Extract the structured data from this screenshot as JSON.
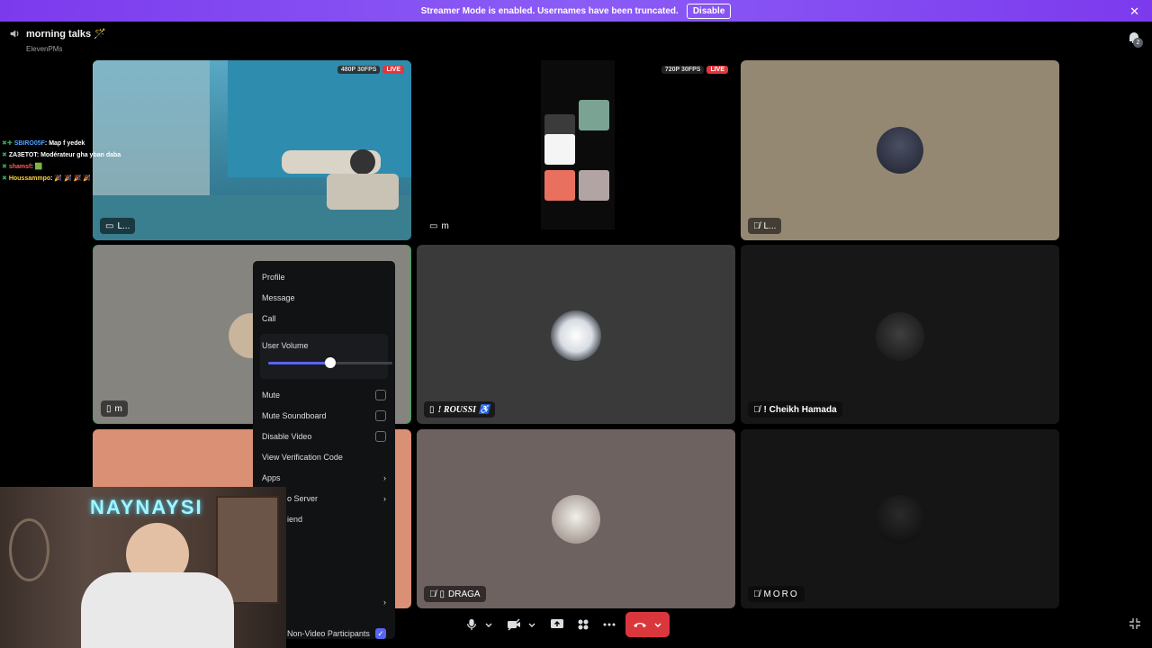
{
  "banner": {
    "message": "Streamer Mode is enabled. Usernames have been truncated.",
    "disable_label": "Disable",
    "close_glyph": "✕"
  },
  "header": {
    "channel_name": "morning talks 🪄",
    "server_name": "ElevenPMs"
  },
  "notifications": {
    "count": "2"
  },
  "tiles": [
    {
      "name": "L...",
      "quality": "480P 30FPS",
      "live": "LIVE"
    },
    {
      "name": "m",
      "quality": "720P 30FPS",
      "live": "LIVE"
    },
    {
      "name": "L..."
    },
    {
      "name": "m"
    },
    {
      "name": "! ROUSSI ♿"
    },
    {
      "name": "! Cheikh Hamada"
    },
    {
      "name": "DRAGA"
    },
    {
      "name": "MORO"
    }
  ],
  "chat_overlay": [
    {
      "user": "SBIRO05F",
      "user_color": "#4fa3ff",
      "text": ": Map f yedek"
    },
    {
      "user": "ZA3ETOT",
      "user_color": "#ffffff",
      "text": ": Modérateur gha yban daba"
    },
    {
      "user": "shamsf",
      "user_color": "#ff5b5b",
      "text": ": 🟩"
    },
    {
      "user": "Houssammpo",
      "user_color": "#ffd23f",
      "text": ": 🎉 🎉 🎉 🎉"
    }
  ],
  "context_menu": {
    "profile": "Profile",
    "message": "Message",
    "call": "Call",
    "user_volume_label": "User Volume",
    "user_volume_fraction": 0.5,
    "mute": "Mute",
    "mute_soundboard": "Mute Soundboard",
    "disable_video": "Disable Video",
    "view_verification_code": "View Verification Code",
    "apps": "Apps",
    "invite_to_server": "o Server",
    "add_friend": "iend",
    "non_video": "Non-Video Participants"
  },
  "webcam": {
    "neon_text": "NAYNAYSI"
  },
  "colors": {
    "accent": "#5865f2",
    "banner": "#8b5cf6",
    "end_call": "#da373c",
    "live": "#e3363b",
    "speaking_border": "#3ba55c"
  }
}
